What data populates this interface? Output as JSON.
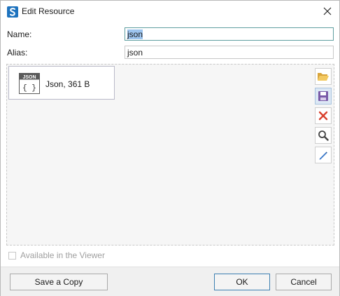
{
  "window": {
    "title": "Edit Resource"
  },
  "form": {
    "name_label": "Name:",
    "name_value": "json",
    "alias_label": "Alias:",
    "alias_value": "json"
  },
  "resource": {
    "icon_badge": "JSON",
    "icon_glyph": "{ }",
    "label": "Json, 361 B"
  },
  "toolbar": {
    "open_icon": "folder-open-icon",
    "save_icon": "save-icon",
    "delete_icon": "delete-icon",
    "view_icon": "magnifier-icon",
    "edit_icon": "pencil-icon"
  },
  "options": {
    "available_in_viewer_label": "Available in the Viewer",
    "available_in_viewer_checked": false
  },
  "buttons": {
    "save_copy": "Save a Copy",
    "ok": "OK",
    "cancel": "Cancel"
  },
  "colors": {
    "focus_border": "#5f9ea0",
    "selection": "#9dc4ee",
    "primary_border": "#3c7fb1"
  }
}
